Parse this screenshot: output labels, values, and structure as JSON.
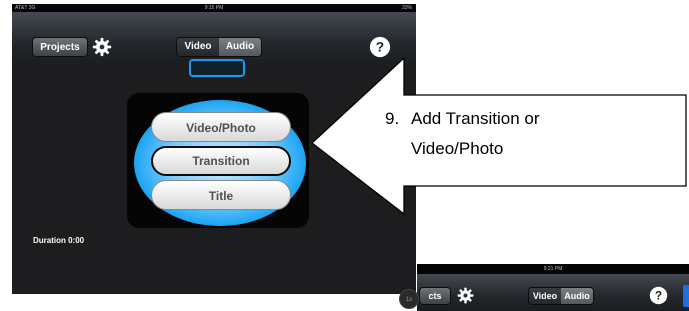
{
  "main_screen": {
    "status": {
      "carrier": "AT&T 3G",
      "time": "9:15 PM",
      "battery": "33%"
    },
    "toolbar": {
      "projects_label": "Projects",
      "segment": {
        "video": "Video",
        "audio": "Audio"
      }
    },
    "menu": {
      "items": [
        "Video/Photo",
        "Transition",
        "Title"
      ]
    },
    "duration": "Duration 0:00"
  },
  "callout": {
    "number": "9.",
    "line1": "Add Transition or",
    "line2": "Video/Photo"
  },
  "second_screen": {
    "status_time": "9:21 PM",
    "projects_partial": "cts",
    "badge": "1x",
    "segment": {
      "video": "Video",
      "audio": "Audio"
    }
  },
  "colors": {
    "accent": "#1ea4f2",
    "toolbar": "#2b2f33"
  }
}
